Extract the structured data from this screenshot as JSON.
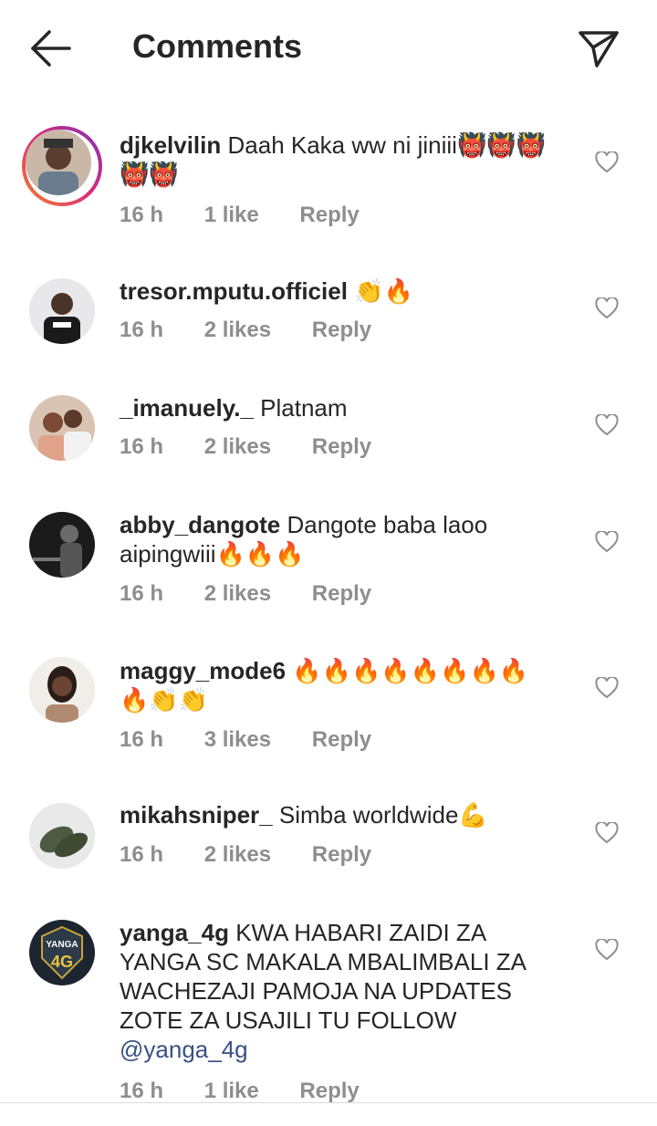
{
  "header": {
    "title": "Comments",
    "back_icon": "arrow-left-icon",
    "send_icon": "paper-plane-icon"
  },
  "comments": [
    {
      "user": "djkelvilin",
      "text": "Daah Kaka ww ni jiniii👹👹👹",
      "text2": "👹👹",
      "time": "16 h",
      "likes": "1 like",
      "reply": "Reply",
      "story_ring": true
    },
    {
      "user": "tresor.mputu.officiel",
      "text": "👏🔥",
      "time": "16 h",
      "likes": "2 likes",
      "reply": "Reply"
    },
    {
      "user": "_imanuely._",
      "text": "Platnam",
      "time": "16 h",
      "likes": "2 likes",
      "reply": "Reply"
    },
    {
      "user": "abby_dangote",
      "text": "Dangote baba laoo",
      "text2": "aipingwiii🔥🔥🔥",
      "time": "16 h",
      "likes": "2 likes",
      "reply": "Reply"
    },
    {
      "user": "maggy_mode6",
      "text": "🔥🔥🔥🔥🔥🔥🔥🔥",
      "text2": "🔥👏👏",
      "time": "16 h",
      "likes": "3 likes",
      "reply": "Reply"
    },
    {
      "user": "mikahsniper_",
      "text": "Simba worldwide💪",
      "time": "16 h",
      "likes": "2 likes",
      "reply": "Reply"
    },
    {
      "user": "yanga_4g",
      "text": "KWA HABARI ZAIDI ZA",
      "text2": "YANGA SC  MAKALA MBALIMBALI ZA",
      "text3": "WACHEZAJI  PAMOJA NA UPDATES",
      "text4": "ZOTE ZA USAJILI TU FOLLOW",
      "mention": "@yanga_4g",
      "time": "16 h",
      "likes": "1 like",
      "reply": "Reply",
      "avatar_text": "YANGA",
      "avatar_text2": "4G"
    }
  ],
  "colors": {
    "text": "#262626",
    "meta": "#8e8e8e",
    "mention": "#385185"
  }
}
